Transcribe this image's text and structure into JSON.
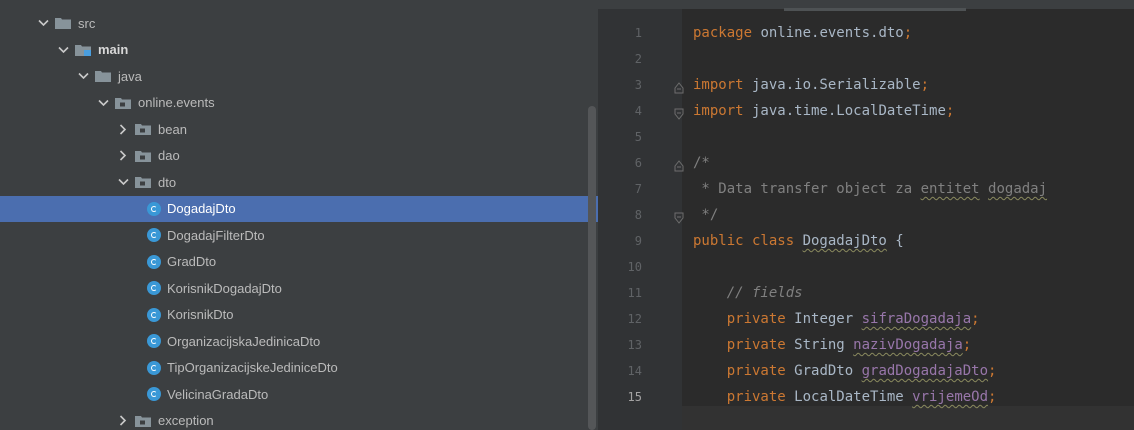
{
  "tree": {
    "rows": [
      {
        "label": "src",
        "depth": 0,
        "expanded": true,
        "icon": "folder-icon",
        "bold": false
      },
      {
        "label": "main",
        "depth": 1,
        "expanded": true,
        "icon": "source-root-folder-icon",
        "bold": true
      },
      {
        "label": "java",
        "depth": 2,
        "expanded": true,
        "icon": "folder-icon",
        "bold": false
      },
      {
        "label": "online.events",
        "depth": 3,
        "expanded": true,
        "icon": "package-icon",
        "bold": false
      },
      {
        "label": "bean",
        "depth": 4,
        "expanded": false,
        "icon": "package-icon",
        "bold": false
      },
      {
        "label": "dao",
        "depth": 4,
        "expanded": false,
        "icon": "package-icon",
        "bold": false
      },
      {
        "label": "dto",
        "depth": 4,
        "expanded": true,
        "icon": "package-icon",
        "bold": false
      },
      {
        "label": "DogadajDto",
        "depth": 5,
        "icon": "class-icon",
        "selected": true
      },
      {
        "label": "DogadajFilterDto",
        "depth": 5,
        "icon": "class-icon"
      },
      {
        "label": "GradDto",
        "depth": 5,
        "icon": "class-icon"
      },
      {
        "label": "KorisnikDogadajDto",
        "depth": 5,
        "icon": "class-icon"
      },
      {
        "label": "KorisnikDto",
        "depth": 5,
        "icon": "class-icon"
      },
      {
        "label": "OrganizacijskaJedinicaDto",
        "depth": 5,
        "icon": "class-icon"
      },
      {
        "label": "TipOrganizacijskeJediniceDto",
        "depth": 5,
        "icon": "class-icon"
      },
      {
        "label": "VelicinaGradaDto",
        "depth": 5,
        "icon": "class-icon"
      },
      {
        "label": "exception",
        "depth": 4,
        "expanded": false,
        "icon": "package-icon",
        "bold": false
      }
    ]
  },
  "editor": {
    "current_line": 15,
    "lines": [
      {
        "n": "1",
        "parts": [
          [
            "kw",
            "package"
          ],
          [
            "t",
            " online.events.dto"
          ],
          [
            "kw",
            ";"
          ]
        ]
      },
      {
        "n": "2",
        "parts": []
      },
      {
        "n": "3",
        "parts": [
          [
            "kw",
            "import"
          ],
          [
            "t",
            " java.io.Serializable"
          ],
          [
            "kw",
            ";"
          ]
        ]
      },
      {
        "n": "4",
        "parts": [
          [
            "kw",
            "import"
          ],
          [
            "t",
            " java.time.LocalDateTime"
          ],
          [
            "kw",
            ";"
          ]
        ]
      },
      {
        "n": "5",
        "parts": []
      },
      {
        "n": "6",
        "parts": [
          [
            "cm",
            "/*"
          ]
        ]
      },
      {
        "n": "7",
        "parts": [
          [
            "cm",
            " * Data transfer object za "
          ],
          [
            "cmu",
            "entitet"
          ],
          [
            "cm",
            " "
          ],
          [
            "cmu",
            "dogadaj"
          ]
        ]
      },
      {
        "n": "8",
        "parts": [
          [
            "cm",
            " */"
          ]
        ]
      },
      {
        "n": "9",
        "parts": [
          [
            "kw",
            "public class "
          ],
          [
            "tu",
            "DogadajDto"
          ],
          [
            "t",
            " {"
          ]
        ]
      },
      {
        "n": "10",
        "parts": []
      },
      {
        "n": "11",
        "parts": [
          [
            "t",
            "    "
          ],
          [
            "cmi",
            "// fields"
          ]
        ]
      },
      {
        "n": "12",
        "parts": [
          [
            "t",
            "    "
          ],
          [
            "kw",
            "private "
          ],
          [
            "t",
            "Integer "
          ],
          [
            "fu",
            "sifraDogadaja"
          ],
          [
            "kw",
            ";"
          ]
        ]
      },
      {
        "n": "13",
        "parts": [
          [
            "t",
            "    "
          ],
          [
            "kw",
            "private "
          ],
          [
            "t",
            "String "
          ],
          [
            "fu",
            "nazivDogadaja"
          ],
          [
            "kw",
            ";"
          ]
        ]
      },
      {
        "n": "14",
        "parts": [
          [
            "t",
            "    "
          ],
          [
            "kw",
            "private "
          ],
          [
            "t",
            "GradDto "
          ],
          [
            "fu",
            "gradDogadajaDto"
          ],
          [
            "kw",
            ";"
          ]
        ]
      },
      {
        "n": "15",
        "parts": [
          [
            "t",
            "    "
          ],
          [
            "kw",
            "private "
          ],
          [
            "t",
            "LocalDateTime "
          ],
          [
            "fu",
            "vrijemeOd"
          ],
          [
            "kw",
            ";"
          ]
        ]
      }
    ],
    "fold_markers": [
      "3",
      "4",
      "6",
      "8"
    ]
  }
}
